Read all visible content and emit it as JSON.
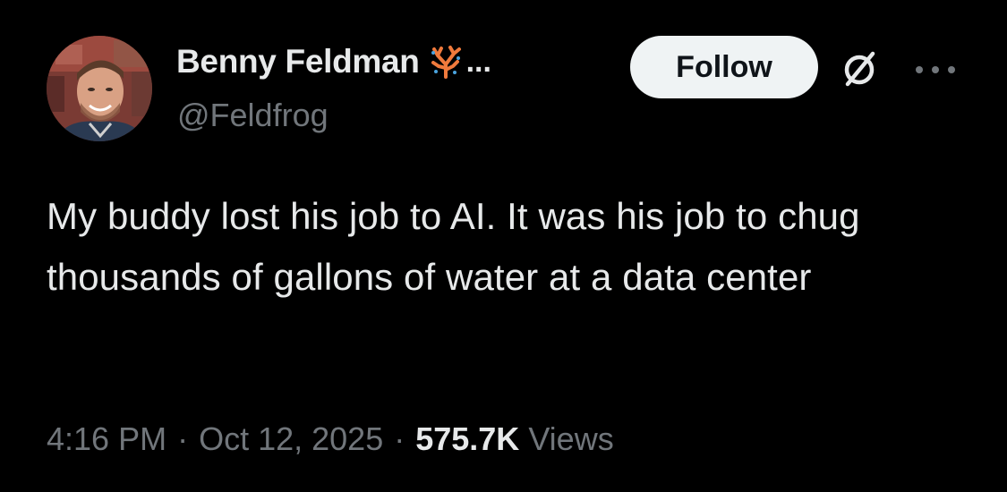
{
  "author": {
    "display_name": "Benny Feldman",
    "handle": "@Feldfrog",
    "name_ellipsis": "..."
  },
  "header": {
    "follow_label": "Follow"
  },
  "tweet": {
    "text": "My buddy lost his job to AI. It was his job to chug thousands of gallons of water at a data center"
  },
  "meta": {
    "time": "4:16 PM",
    "separator": "·",
    "date": "Oct 12, 2025",
    "views_count": "575.7K",
    "views_label": "Views"
  },
  "icons": {
    "badge": "coral-emoji-icon",
    "grok": "grok-icon",
    "more": "more-icon"
  },
  "colors": {
    "background": "#000000",
    "primary_text": "#e7e9ea",
    "secondary_text": "#71767b",
    "follow_bg": "#eff3f4",
    "follow_text": "#0f1419",
    "badge_accent": "#f07a3c"
  }
}
